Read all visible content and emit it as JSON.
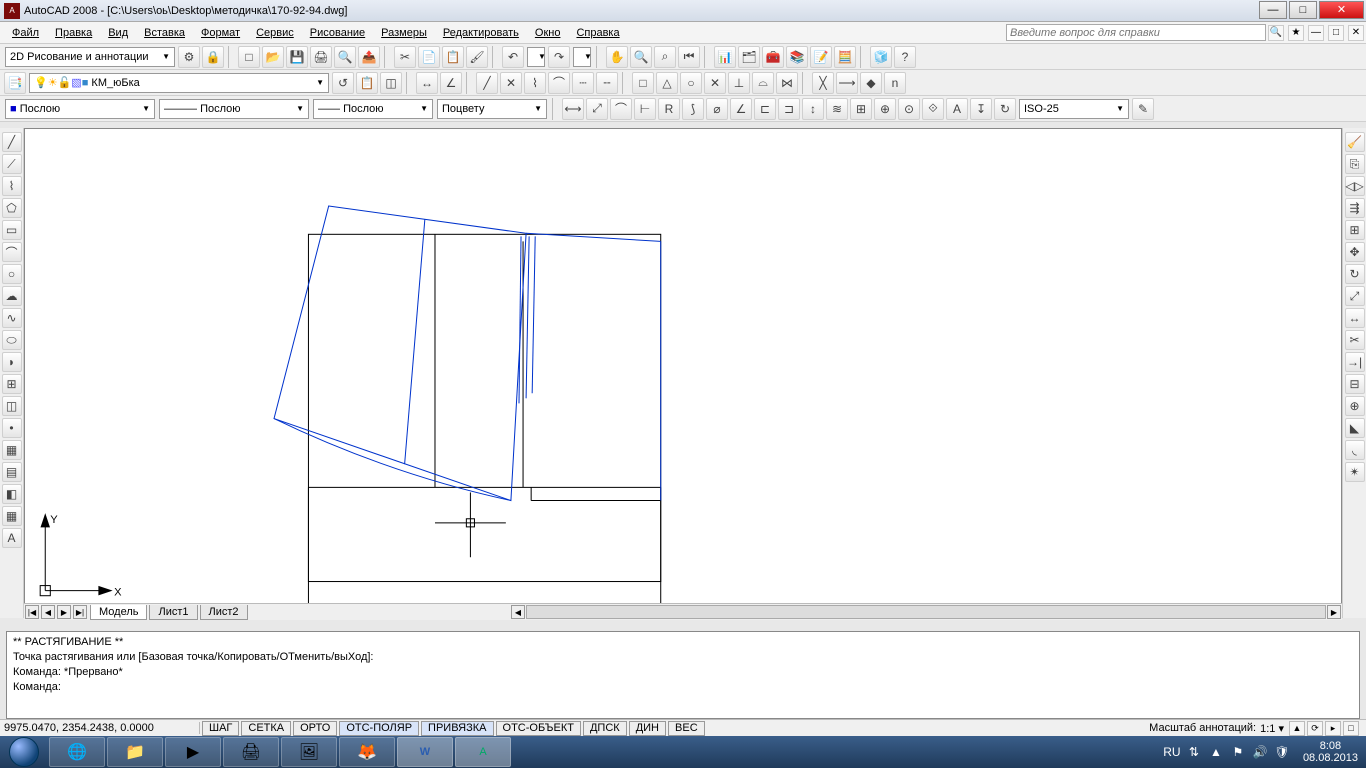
{
  "titlebar": {
    "app": "AutoCAD 2008",
    "path": "[C:\\Users\\оь\\Desktop\\методичка\\170-92-94.dwg]"
  },
  "menu": {
    "items": [
      "Файл",
      "Правка",
      "Вид",
      "Вставка",
      "Формат",
      "Сервис",
      "Рисование",
      "Размеры",
      "Редактировать",
      "Окно",
      "Справка"
    ],
    "help_placeholder": "Введите вопрос для справки"
  },
  "row1": {
    "workspace": "2D Рисование и аннотации"
  },
  "row2": {
    "layer": "КМ_юБка"
  },
  "row3": {
    "color": "Послою",
    "linetype": "Послою",
    "lineweight": "Послою",
    "plotstyle": "Поцвету",
    "dimstyle": "ISO-25"
  },
  "tabs": {
    "nav": [
      "|◀",
      "◀",
      "▶",
      "▶|"
    ],
    "model": "Модель",
    "layout1": "Лист1",
    "layout2": "Лист2"
  },
  "cmd": {
    "l1": "** РАСТЯГИВАНИЕ **",
    "l2": "Точка растягивания или [Базовая точка/Копировать/ОТменить/выХод]:",
    "l3": "Команда: *Прервано*",
    "l4": "",
    "l5": "Команда:"
  },
  "status": {
    "coords": "9975.0470, 2354.2438, 0.0000",
    "toggles": [
      "ШАГ",
      "СЕТКА",
      "ОРТО",
      "ОТС-ПОЛЯР",
      "ПРИВЯЗКА",
      "ОТС-ОБЪЕКТ",
      "ДПСК",
      "ДИН",
      "ВЕС"
    ],
    "scale_label": "Масштаб аннотаций:",
    "scale_value": "1:1 ▾"
  },
  "tray": {
    "lang": "RU",
    "time": "8:08",
    "date": "08.08.2013"
  },
  "ucs": {
    "y": "Y",
    "x": "X"
  }
}
